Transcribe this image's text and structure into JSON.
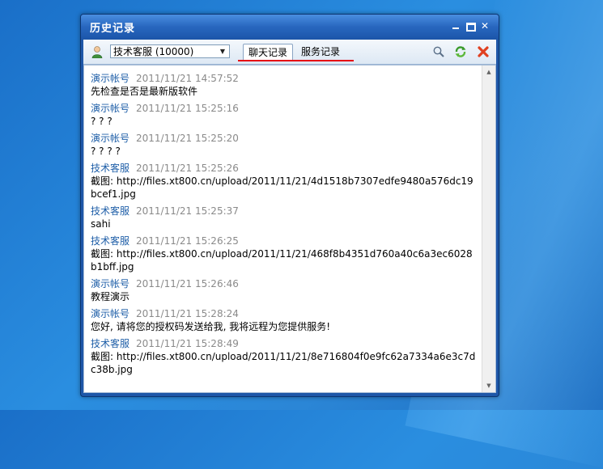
{
  "window": {
    "title": "历史记录"
  },
  "toolbar": {
    "contact_select": "技术客服 (10000)",
    "tabs": [
      {
        "label": "聊天记录",
        "active": true
      },
      {
        "label": "服务记录",
        "active": false
      }
    ],
    "accent_color": "#e60012"
  },
  "messages": [
    {
      "sender": "演示帐号",
      "time": "2011/11/21 14:57:52",
      "body": "先检查是否是最新版软件"
    },
    {
      "sender": "演示帐号",
      "time": "2011/11/21 15:25:16",
      "body": "? ? ?"
    },
    {
      "sender": "演示帐号",
      "time": "2011/11/21 15:25:20",
      "body": "? ? ? ?"
    },
    {
      "sender": "技术客服",
      "time": "2011/11/21 15:25:26",
      "body": "截图: http://files.xt800.cn/upload/2011/11/21/4d1518b7307edfe9480a576dc19bcef1.jpg"
    },
    {
      "sender": "技术客服",
      "time": "2011/11/21 15:25:37",
      "body": "sahi"
    },
    {
      "sender": "技术客服",
      "time": "2011/11/21 15:26:25",
      "body": "截图: http://files.xt800.cn/upload/2011/11/21/468f8b4351d760a40c6a3ec6028b1bff.jpg"
    },
    {
      "sender": "演示帐号",
      "time": "2011/11/21 15:26:46",
      "body": "教程演示"
    },
    {
      "sender": "演示帐号",
      "time": "2011/11/21 15:28:24",
      "body": "您好, 请将您的授权码发送给我, 我将远程为您提供服务!"
    },
    {
      "sender": "技术客服",
      "time": "2011/11/21 15:28:49",
      "body": "截图: http://files.xt800.cn/upload/2011/11/21/8e716804f0e9fc62a7334a6e3c7dc38b.jpg"
    }
  ]
}
